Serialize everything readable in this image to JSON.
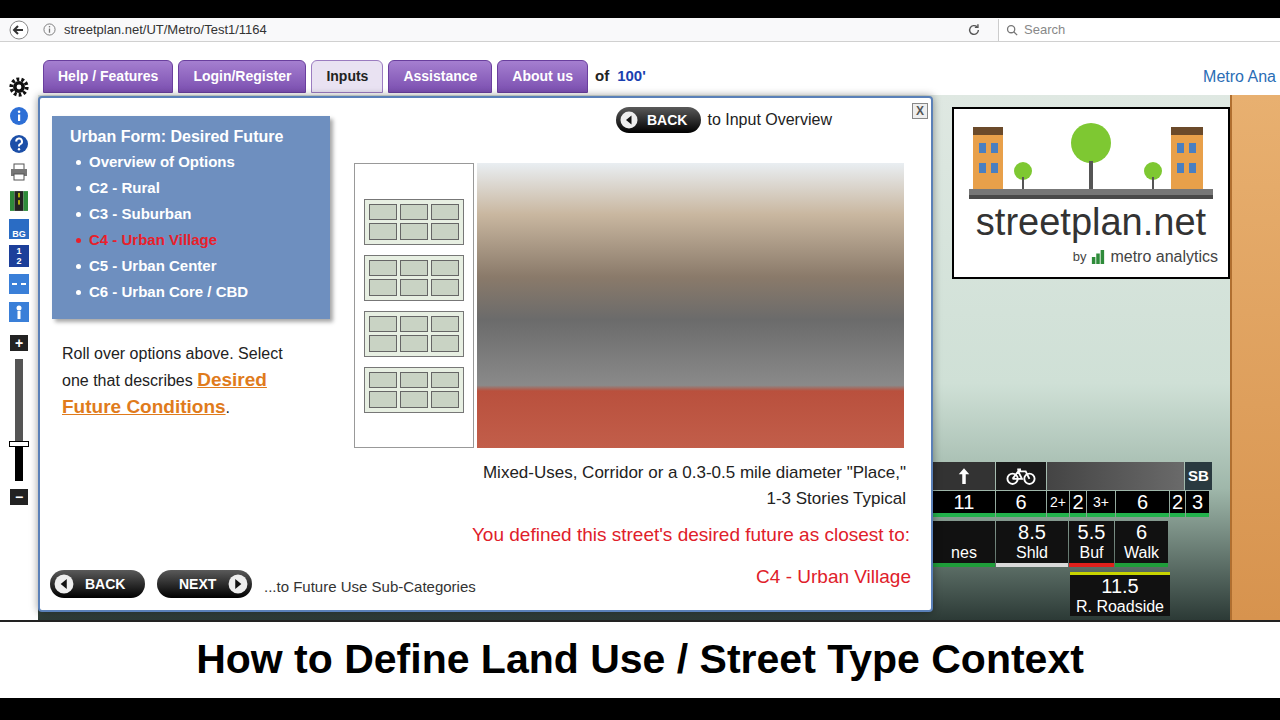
{
  "browser": {
    "url": "streetplan.net/UT/Metro/Test1/1164",
    "search_placeholder": "Search"
  },
  "toolbar": {
    "bg_label": "BG",
    "layer_labels": [
      "1",
      "2"
    ],
    "zoom_in": "+",
    "zoom_out": "−",
    "zoom_level": 0.3
  },
  "nav_tabs": [
    {
      "label": "Help / Features",
      "selected": false
    },
    {
      "label": "Login/Register",
      "selected": false
    },
    {
      "label": "Inputs",
      "selected": true
    },
    {
      "label": "Assistance",
      "selected": false
    },
    {
      "label": "About us",
      "selected": false
    }
  ],
  "scale": {
    "prefix": "of",
    "value": "100'"
  },
  "brand_link": "Metro Ana",
  "modal": {
    "close": "X",
    "top_back": {
      "label": "BACK",
      "suffix": "to Input Overview"
    },
    "menu": {
      "title": "Urban Form: Desired Future",
      "items": [
        {
          "label": "Overview of Options",
          "selected": false
        },
        {
          "label": "C2 - Rural",
          "selected": false
        },
        {
          "label": "C3 - Suburban",
          "selected": false
        },
        {
          "label": "C4 - Urban Village",
          "selected": true
        },
        {
          "label": "C5 - Urban Center",
          "selected": false
        },
        {
          "label": "C6 - Urban Core / CBD",
          "selected": false
        }
      ]
    },
    "hint": "Roll over options above. Select one that describes",
    "hint_link": "Desired Future Conditions",
    "hint_end": ".",
    "caption_lines": [
      "Mixed-Uses, Corridor or a 0.3-0.5 mile diameter \"Place,\"",
      "1-3 Stories Typical"
    ],
    "result_label": "You defined this street's desired future as closest to:",
    "result_value": "C4 - Urban Village",
    "back": "BACK",
    "next": "NEXT",
    "next_suffix": "...to Future Use Sub-Categories"
  },
  "logo": {
    "name": "streetplan.net",
    "by": "by",
    "company": "metro analytics"
  },
  "lanes": {
    "direction": "SB",
    "widths": [
      {
        "label": "11"
      },
      {
        "label": "6"
      },
      {
        "label": "2+"
      },
      {
        "label": "2"
      },
      {
        "label": "3+"
      },
      {
        "label": "6"
      },
      {
        "label": "2"
      },
      {
        "label": "3"
      }
    ],
    "segments": [
      {
        "lines": [
          "nes"
        ],
        "color": "#1f9d3a"
      },
      {
        "lines": [
          "8.5",
          "Shld"
        ],
        "color": "#d9d9d9"
      },
      {
        "lines": [
          "5.5",
          "Buf"
        ],
        "color": "#e0201c"
      },
      {
        "lines": [
          "6",
          "Walk"
        ],
        "color": "#1f9d3a"
      }
    ],
    "roadside": {
      "lines": [
        "11.5",
        "R. Roadside"
      ],
      "color": "#c8d400"
    }
  },
  "title": "How to Define Land Use / Street Type Context"
}
